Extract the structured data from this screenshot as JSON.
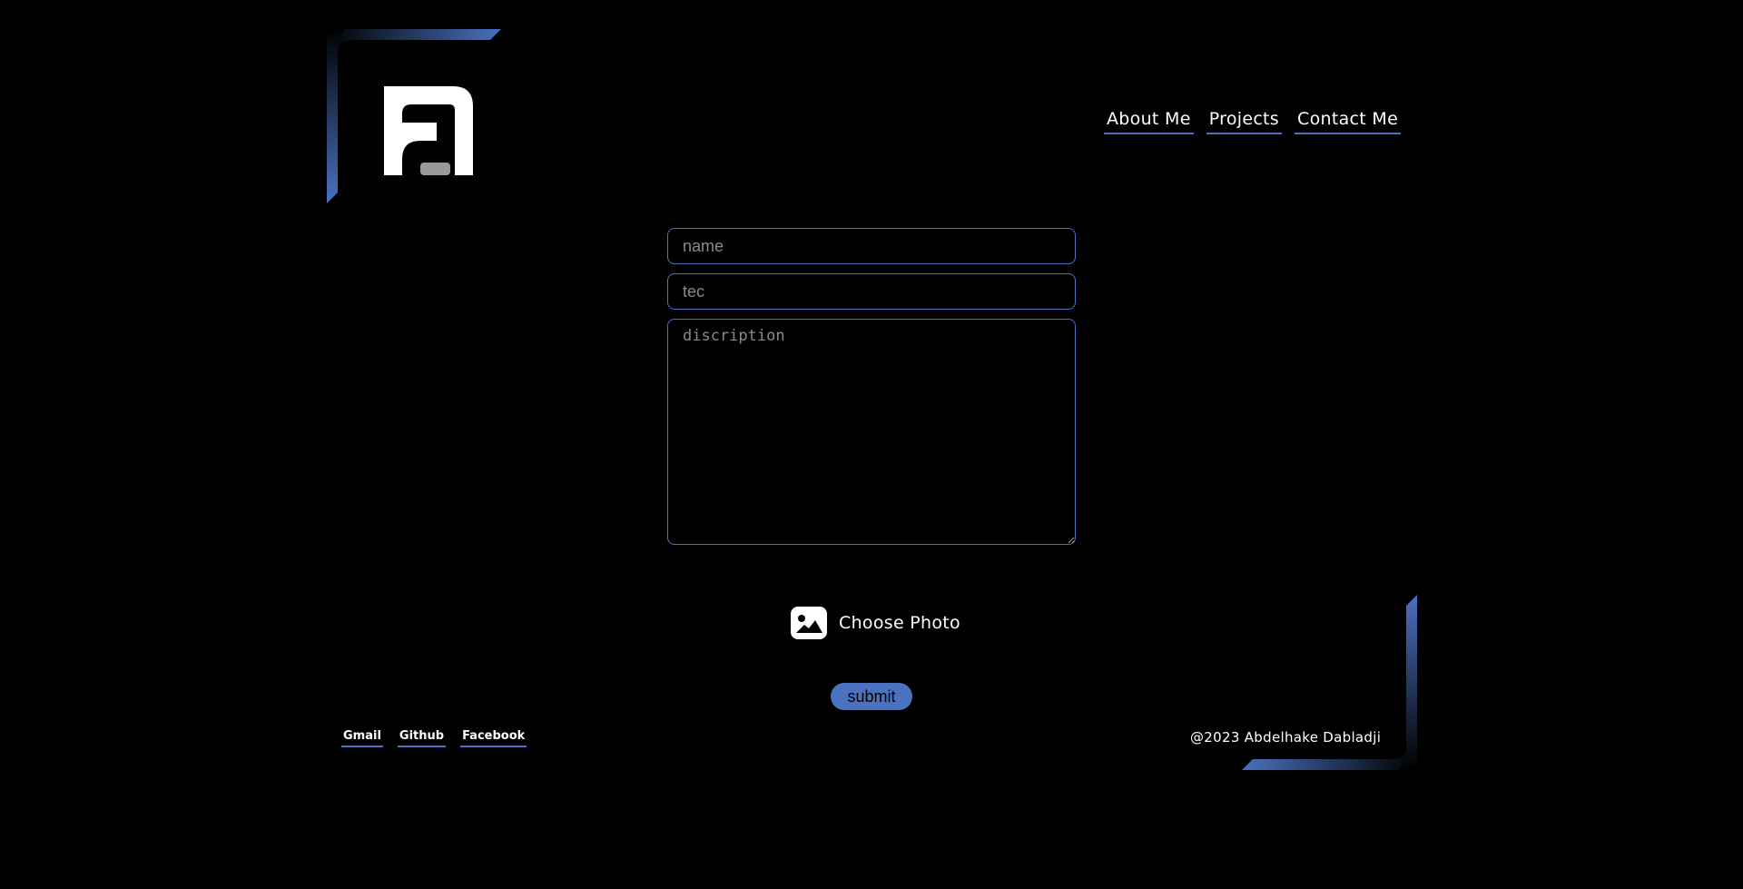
{
  "nav": {
    "items": [
      {
        "label": "About Me"
      },
      {
        "label": "Projects"
      },
      {
        "label": "Contact Me"
      }
    ]
  },
  "form": {
    "name_placeholder": "name",
    "tec_placeholder": "tec",
    "description_placeholder": "discription",
    "choose_photo_label": "Choose Photo",
    "submit_label": "submit"
  },
  "footer": {
    "links": [
      {
        "label": "Gmail"
      },
      {
        "label": "Github"
      },
      {
        "label": "Facebook"
      }
    ],
    "copyright": "@2023 Abdelhake Dabladji"
  },
  "colors": {
    "accent": "#4a72c0",
    "background": "#000000",
    "text": "#ffffff",
    "placeholder": "#8a8a8a"
  },
  "icons": {
    "logo": "brand-logo-icon",
    "photo": "image-icon"
  }
}
